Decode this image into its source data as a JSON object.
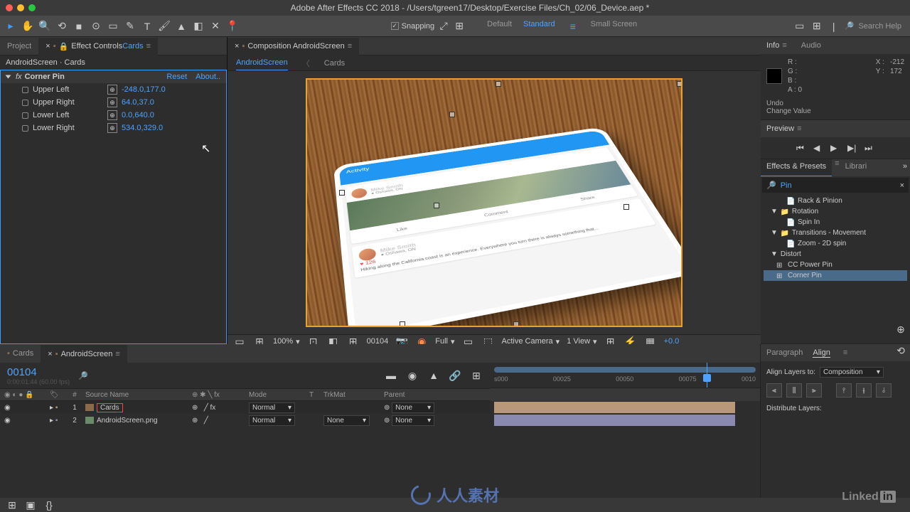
{
  "title": "Adobe After Effects CC 2018 - /Users/tgreen17/Desktop/Exercise Files/Ch_02/06_Device.aep *",
  "toolbar": {
    "snapping_label": "Snapping",
    "workspaces": [
      "Default",
      "Standard",
      "Small Screen"
    ],
    "active_workspace": "Standard",
    "search_placeholder": "Search Help"
  },
  "left": {
    "tabs": {
      "project": "Project",
      "ec_prefix": "Effect Controls ",
      "ec_layer": "Cards"
    },
    "ec_header": "AndroidScreen · Cards",
    "effect": {
      "name": "Corner Pin",
      "reset": "Reset",
      "about": "About..",
      "props": [
        {
          "name": "Upper Left",
          "value": "-248.0,177.0"
        },
        {
          "name": "Upper Right",
          "value": "64.0,37.0"
        },
        {
          "name": "Lower Left",
          "value": "0.0,640.0"
        },
        {
          "name": "Lower Right",
          "value": "534.0,329.0"
        }
      ]
    }
  },
  "comp": {
    "tab_label": "Composition AndroidScreen",
    "subtabs": [
      "AndroidScreen",
      "Cards"
    ],
    "active_sub": "AndroidScreen",
    "mockup": {
      "app_title": "Activity",
      "user": "Mike Smith",
      "loc": "Oshawa, ON",
      "likes": "126",
      "actions": [
        "Like",
        "Comment",
        "Share"
      ],
      "caption": "Hiking along the California coast is an experience. Everywhere you turn there is always something that..."
    },
    "footer": {
      "zoom": "100%",
      "timecode": "00104",
      "quality": "Full",
      "camera": "Active Camera",
      "view": "1 View",
      "exposure": "+0.0"
    }
  },
  "right": {
    "info": {
      "label": "Info",
      "R": "R :",
      "G": "G :",
      "B": "B :",
      "A": "A :",
      "A_val": "0",
      "X": "X :",
      "X_val": "-212",
      "Y": "Y :",
      "Y_val": "172"
    },
    "audio": "Audio",
    "history": [
      "Undo",
      "Change Value"
    ],
    "preview": "Preview",
    "ep": {
      "tab1": "Effects & Presets",
      "tab2": "Librari",
      "search": "Pin",
      "tree": [
        {
          "l": 3,
          "t": "Rack & Pinion",
          "i": "preset"
        },
        {
          "l": 1,
          "t": "Rotation",
          "i": "folder",
          "tw": true
        },
        {
          "l": 3,
          "t": "Spin In",
          "i": "preset"
        },
        {
          "l": 1,
          "t": "Transitions - Movement",
          "i": "folder",
          "tw": true
        },
        {
          "l": 3,
          "t": "Zoom - 2D spin",
          "i": "preset"
        },
        {
          "l": 1,
          "t": "Distort",
          "i": "cat",
          "tw": true
        },
        {
          "l": 2,
          "t": "CC Power Pin",
          "i": "fx"
        },
        {
          "l": 2,
          "t": "Corner Pin",
          "i": "fx",
          "sel": true
        }
      ]
    }
  },
  "timeline": {
    "tabs": [
      "Cards",
      "AndroidScreen"
    ],
    "active": "AndroidScreen",
    "timecode": "00104",
    "sub": "0:00:01:44 (60.00 fps)",
    "cols": {
      "num": "#",
      "source": "Source Name",
      "mode": "Mode",
      "trk": "TrkMat",
      "parent": "Parent"
    },
    "layers": [
      {
        "n": "1",
        "name": "Cards",
        "mode": "Normal",
        "trk": "",
        "parent": "None",
        "color": "#b89878",
        "icon": "comp"
      },
      {
        "n": "2",
        "name": "AndroidScreen.png",
        "mode": "Normal",
        "trk": "None",
        "parent": "None",
        "color": "#8a8ab0",
        "icon": "img"
      }
    ],
    "ruler": [
      "s000",
      "00025",
      "00050",
      "00075",
      "0010"
    ]
  },
  "align": {
    "tab1": "Paragraph",
    "tab2": "Align",
    "label": "Align Layers to:",
    "target": "Composition",
    "dist": "Distribute Layers:"
  },
  "watermark": "人人素材",
  "linkedin": "Linked"
}
